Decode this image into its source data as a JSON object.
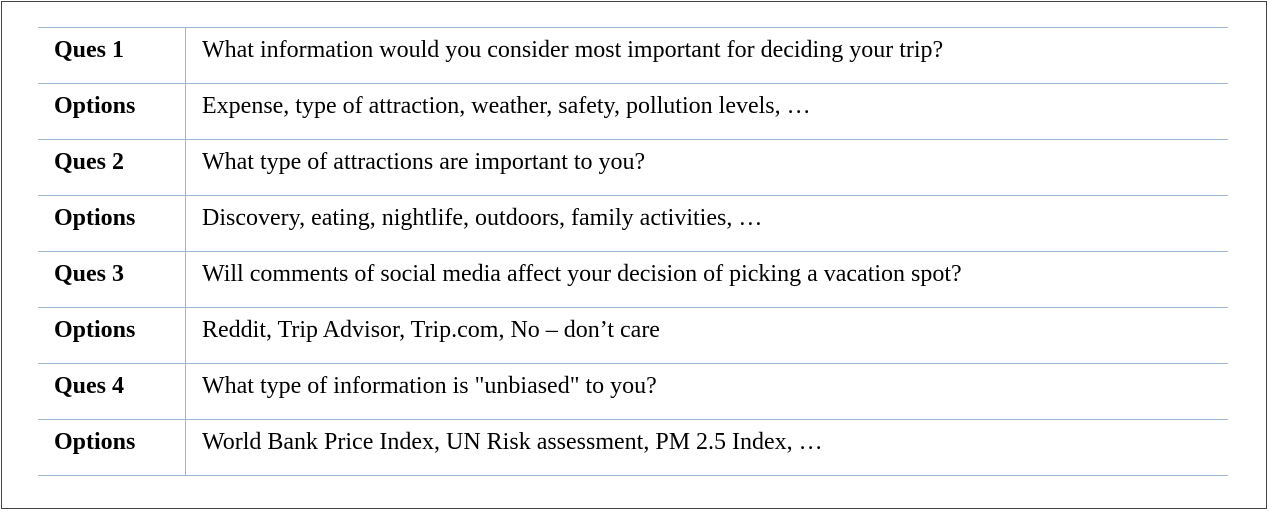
{
  "rows": [
    {
      "label": "Ques 1",
      "text": "What information would you consider most important for deciding your trip?"
    },
    {
      "label": "Options",
      "text": "Expense, type of attraction, weather, safety, pollution levels, …"
    },
    {
      "label": "Ques 2",
      "text": "What type of attractions are important to you?"
    },
    {
      "label": "Options",
      "text": "Discovery, eating, nightlife, outdoors, family activities, …"
    },
    {
      "label": "Ques 3",
      "text": "Will comments of social media affect your decision of picking a vacation spot?"
    },
    {
      "label": "Options",
      "text": "Reddit, Trip Advisor, Trip.com, No – don’t care"
    },
    {
      "label": "Ques 4",
      "text": "What type of information is \"unbiased\" to you?"
    },
    {
      "label": "Options",
      "text": "World Bank Price Index, UN Risk assessment, PM 2.5 Index, …"
    }
  ],
  "colors": {
    "rule": "#9db6d4",
    "frame": "#444444"
  }
}
